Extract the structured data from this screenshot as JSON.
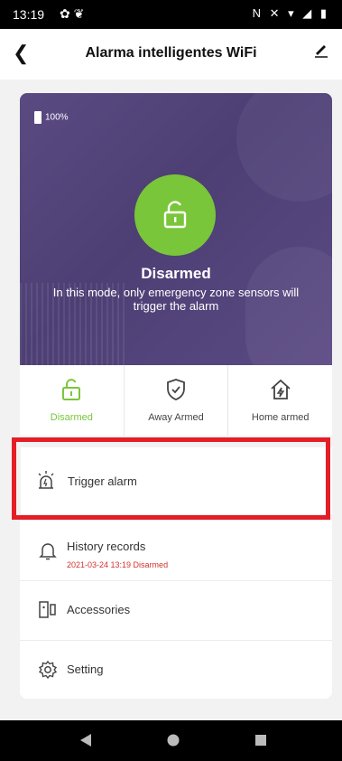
{
  "status_bar": {
    "time": "13:19",
    "left_icons": "✿ ❦",
    "right_icons": "N ✕ ▾ ◢ ▮"
  },
  "header": {
    "title": "Alarma intelligentes WiFi"
  },
  "hero": {
    "battery": "100%",
    "mode_title": "Disarmed",
    "mode_description": "In this mode,  only emergency zone sensors will trigger the alarm"
  },
  "modes": [
    {
      "label": "Disarmed",
      "icon": "unlock-icon",
      "active": true
    },
    {
      "label": "Away Armed",
      "icon": "shield-check-icon",
      "active": false
    },
    {
      "label": "Home armed",
      "icon": "home-bolt-icon",
      "active": false
    }
  ],
  "trigger": {
    "label": "Trigger alarm",
    "icon": "siren-icon"
  },
  "menu": [
    {
      "label": "History records",
      "sub": "2021-03-24 13:19 Disarmed",
      "icon": "bell-icon"
    },
    {
      "label": "Accessories",
      "icon": "accessories-icon"
    },
    {
      "label": "Setting",
      "icon": "gear-icon"
    }
  ],
  "colors": {
    "accent": "#7ac63a",
    "highlight": "#e41e26",
    "hero_bg": "#4d3f74",
    "sub_text": "#d3312b"
  }
}
